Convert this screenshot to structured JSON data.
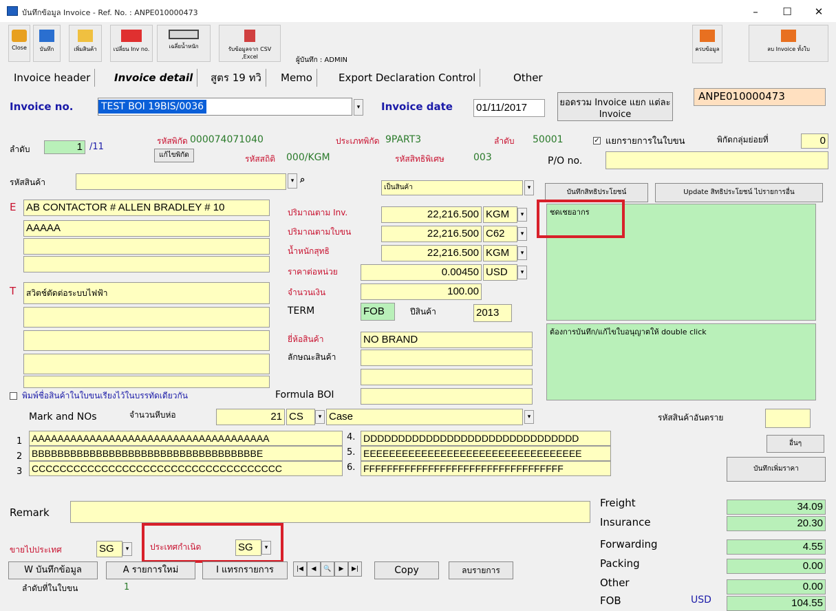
{
  "window": {
    "title": "บันทึกข้อมูล Invoice - Ref. No. : ANPE010000473",
    "minimize": "–",
    "maximize": "☐",
    "close": "✕"
  },
  "toolbar": {
    "close": "Close",
    "save": "บันทึก",
    "add_product": "เพิ่มสินค้า",
    "change_inv": "เปลี่ยน Inv no.",
    "weight": "เฉลี่ยน้ำหนัก",
    "import_csv": "รับข้อมูลจาก CSV ,Excel",
    "recorder": "ผู้บันทึก : ADMIN",
    "extra_info": "ครบข้อมูล",
    "delete_invoice": "ลบ Invoice ทั้งใบ"
  },
  "tabs": [
    "Invoice header",
    "Invoice detail",
    "สูตร 19 ทวิ",
    "Memo",
    "Export Declaration Control",
    "Other"
  ],
  "header": {
    "invoice_no_label": "Invoice no.",
    "invoice_no": "TEST BOI 19BIS/0036",
    "invoice_date_label": "Invoice date",
    "invoice_date": "01/11/2017",
    "total_label": "ยอดรวม Invoice แยก แต่ละ Invoice",
    "ref_no": "ANPE010000473"
  },
  "item": {
    "seq_label": "ลำดับ",
    "seq": "1",
    "seq_total": "/11",
    "tariff_label": "รหัสพิกัด",
    "tariff": "000074071040",
    "edit_tariff": "แก้ไขพิกัด",
    "stat_label": "รหัสสถิติ",
    "stat": "000/KGM",
    "type_label": "ประเภทพิกัด",
    "type": "9PART3",
    "priv_label": "รหัสสิทธิพิเศษ",
    "priv": "003",
    "sub_label": "ลำดับ",
    "sub": "50001",
    "split_label": "แยกรายการในใบขน",
    "group_label": "พิกัดกลุ่มย่อยที่",
    "group": "0",
    "po_label": "P/O no.",
    "po": "",
    "product_code_label": "รหัสสินค้า",
    "product_code": "",
    "goods_type": "เป็นสินค้า",
    "benefit_btn": "บันทึกสิทธิประโยชน์",
    "update_btn": "Update สิทธิประโยชน์ ไปรายการอื่น",
    "benefit_text": "ชดเชยอากร",
    "license_text": "ต้องการบันทึก/แก้ไขใบอนุญาตให้ double click"
  },
  "desc": {
    "e_mark": "E",
    "t_mark": "T",
    "e_lines": [
      "AB CONTACTOR # ALLEN BRADLEY # 10",
      "AAAAA",
      "",
      ""
    ],
    "t_lines": [
      "สวิตช์ตัดต่อระบบไฟฟ้า",
      "",
      "",
      "",
      ""
    ]
  },
  "qty": {
    "inv_label": "ปริมาณตาม Inv.",
    "inv": "22,216.500",
    "inv_unit": "KGM",
    "decl_label": "ปริมาณตามใบขน",
    "decl": "22,216.500",
    "decl_unit": "C62",
    "net_label": "น้ำหนักสุทธิ",
    "net": "22,216.500",
    "net_unit": "KGM",
    "price_label": "ราคาต่อหน่วย",
    "price": "0.00450",
    "currency": "USD",
    "amount_label": "จำนวนเงิน",
    "amount": "100.00",
    "term_label": "TERM",
    "term": "FOB",
    "year_label": "ปีสินค้า",
    "year": "2013",
    "brand_label": "ยี่ห้อสินค้า",
    "brand": "NO BRAND",
    "feature_label": "ลักษณะสินค้า"
  },
  "marks": {
    "print_check_label": "พิมพ์ชื่อสินค้าในใบขนเรียงไว้ในบรรทัดเดียวกัน",
    "formula_label": "Formula BOI",
    "mark_label": "Mark and NOs",
    "pkg_label": "จำนวนหีบห่อ",
    "pkg_qty": "21",
    "pkg_unit": "CS",
    "pkg_desc": "Case",
    "danger_label": "รหัสสินค้าอันตราย",
    "line_nums": [
      "1",
      "2",
      "3",
      "4.",
      "5.",
      "6."
    ],
    "lines_left": [
      "AAAAAAAAAAAAAAAAAAAAAAAAAAAAAAAAAAAAA",
      "BBBBBBBBBBBBBBBBBBBBBBBBBBBBBBBBBBBE",
      "CCCCCCCCCCCCCCCCCCCCCCCCCCCCCCCCCCCC"
    ],
    "lines_right": [
      "DDDDDDDDDDDDDDDDDDDDDDDDDDDDDDD",
      "EEEEEEEEEEEEEEEEEEEEEEEEEEEEEEEEEE",
      "FFFFFFFFFFFFFFFFFFFFFFFFFFFFFFFFFF"
    ],
    "other_btn": "อื่นๆ",
    "add_price_btn": "บันทึกเพิ่มราคา"
  },
  "footer": {
    "remark_label": "Remark",
    "remark": "",
    "country_to_label": "ขายไปประเทศ",
    "country_to": "SG",
    "origin_label": "ประเทศกำเนิด",
    "origin": "SG",
    "save_btn": "W บันทึกข้อมูล",
    "new_btn": "A รายการใหม่",
    "insert_btn": "I แทรกรายการ",
    "nav": [
      "|◀",
      "◀",
      "🔍",
      "▶",
      "▶|"
    ],
    "copy_btn": "Copy",
    "delete_btn": "ลบรายการ",
    "seq_in_doc_label": "ลำดับที่ในใบขน",
    "seq_in_doc": "1"
  },
  "costs": {
    "freight_label": "Freight",
    "freight": "34.09",
    "insurance_label": "Insurance",
    "insurance": "20.30",
    "forwarding_label": "Forwarding",
    "forwarding": "4.55",
    "packing_label": "Packing",
    "packing": "0.00",
    "other_label": "Other",
    "other": "0.00",
    "fob_label": "FOB",
    "fob_cur": "USD",
    "fob": "104.55"
  }
}
